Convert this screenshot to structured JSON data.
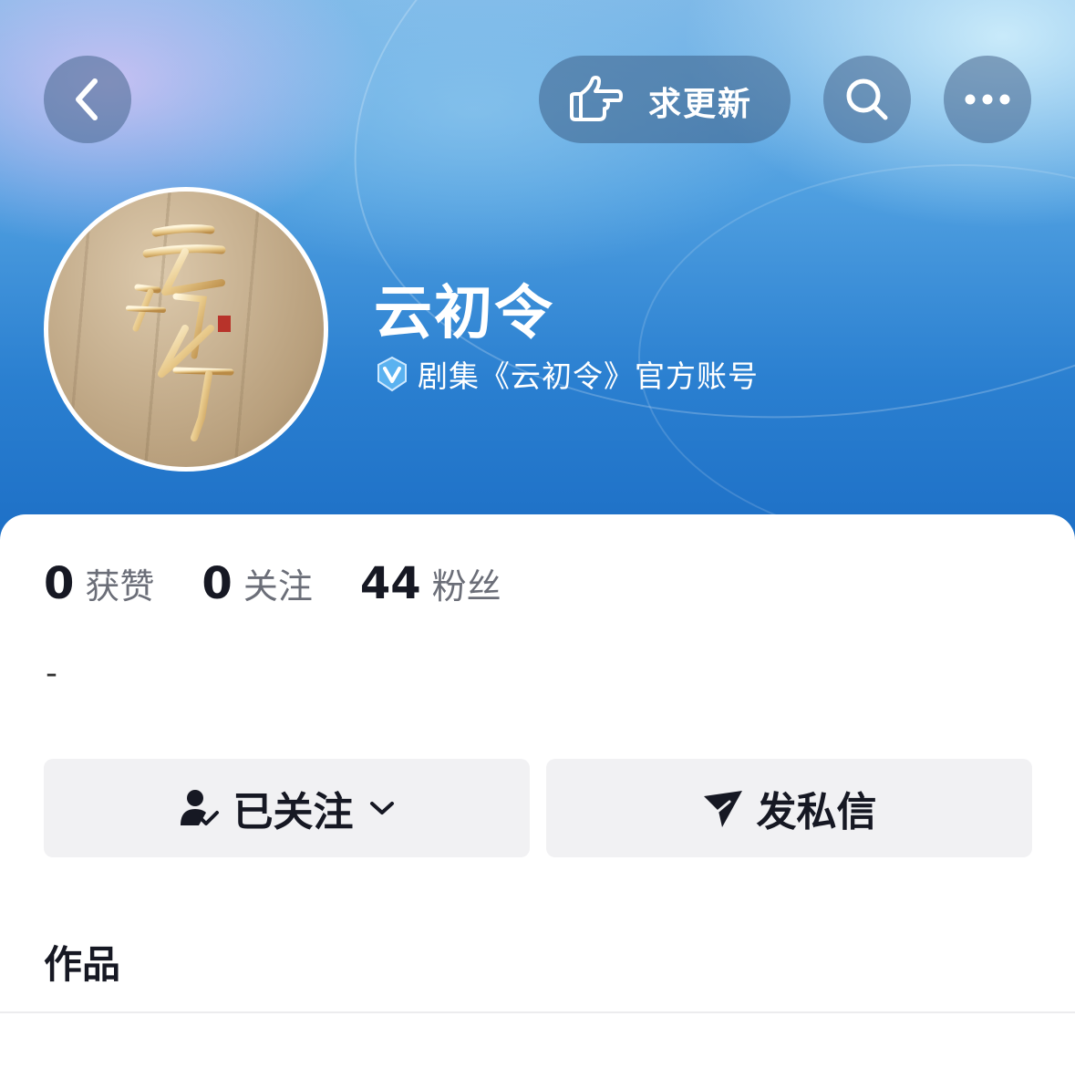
{
  "header": {
    "request_update_label": "求更新"
  },
  "profile": {
    "name": "云初令",
    "verification": "剧集《云初令》官方账号",
    "avatar_text": "云初令"
  },
  "stats": [
    {
      "value": "0",
      "label": "获赞"
    },
    {
      "value": "0",
      "label": "关注"
    },
    {
      "value": "44",
      "label": "粉丝"
    }
  ],
  "bio": "-",
  "actions": {
    "followed_label": "已关注",
    "message_label": "发私信"
  },
  "section": {
    "works_label": "作品"
  },
  "colors": {
    "hero_blue": "#2a7fd0",
    "text_primary": "#161823",
    "text_secondary": "#6b6e78",
    "button_bg": "#f1f1f3"
  },
  "icons": [
    "back-icon",
    "pointing-hand-icon",
    "search-icon",
    "more-icon",
    "verified-badge-icon",
    "followed-user-icon",
    "chevron-down-icon",
    "send-icon"
  ]
}
